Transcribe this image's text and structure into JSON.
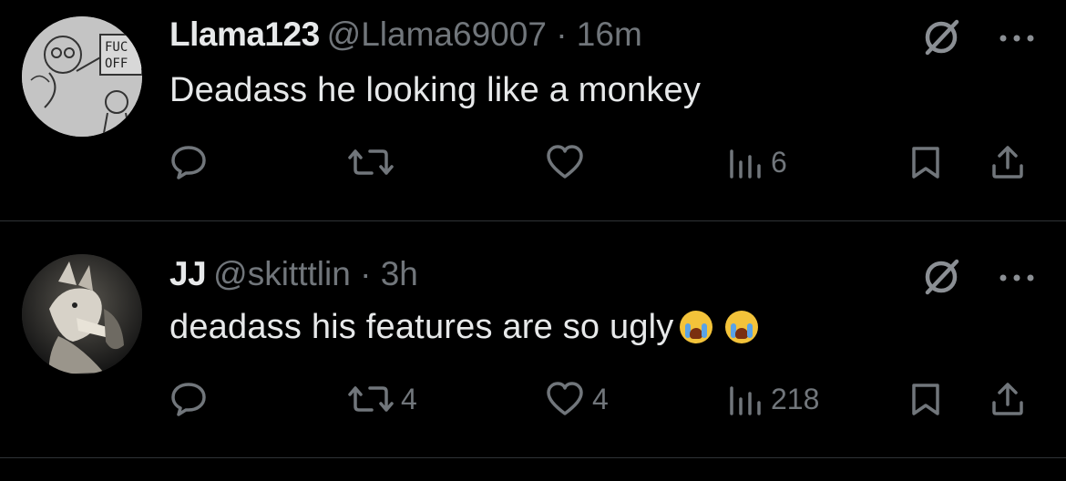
{
  "tweets": [
    {
      "name": "Llama123",
      "handle": "@Llama69007",
      "separator": "·",
      "time": "16m",
      "text": "Deadass he looking like a monkey",
      "emoji_count": 0,
      "avatar_sign_text": "FUC OFF",
      "actions": {
        "replies": "",
        "retweets": "",
        "likes": "",
        "views": "6"
      }
    },
    {
      "name": "JJ",
      "handle": "@skitttlin",
      "separator": "·",
      "time": "3h",
      "text": "deadass his features are so ugly",
      "emoji_count": 2,
      "avatar": "wolf-avatar",
      "actions": {
        "replies": "",
        "retweets": "4",
        "likes": "4",
        "views": "218"
      }
    }
  ],
  "icons": {
    "grok": "no-entry-circle-icon",
    "more": "ellipsis-icon",
    "reply": "reply-icon",
    "retweet": "retweet-icon",
    "like": "heart-icon",
    "views": "views-icon",
    "bookmark": "bookmark-icon",
    "share": "share-icon"
  },
  "colors": {
    "background": "#000000",
    "primary_text": "#e7e9ea",
    "secondary_text": "#71767b",
    "divider": "#2f3336"
  }
}
